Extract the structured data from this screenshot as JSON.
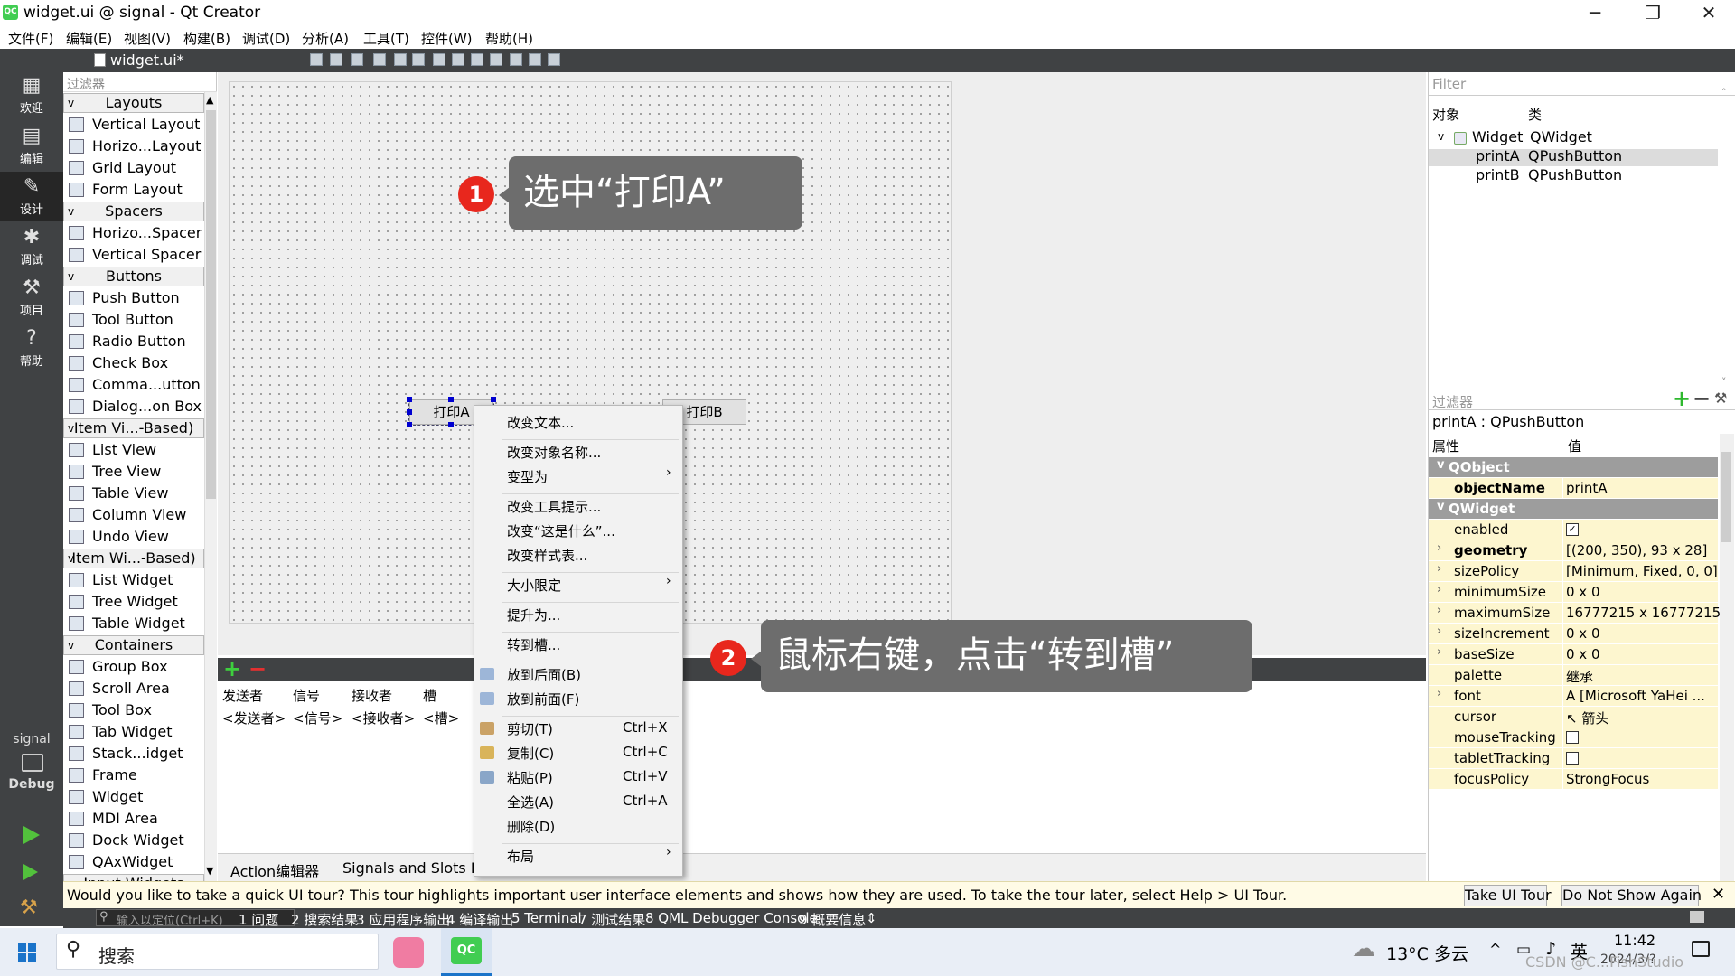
{
  "window": {
    "title": "widget.ui @ signal - Qt Creator",
    "min": "─",
    "max": "❐",
    "close": "✕",
    "logo": "QC"
  },
  "menu": [
    "文件(F)",
    "编辑(E)",
    "视图(V)",
    "构建(B)",
    "调试(D)",
    "分析(A)",
    "工具(T)",
    "控件(W)",
    "帮助(H)"
  ],
  "modes": [
    {
      "label": "欢迎",
      "icon": "grid-icon",
      "glyph": "▦"
    },
    {
      "label": "编辑",
      "icon": "document-icon",
      "glyph": "▤"
    },
    {
      "label": "设计",
      "icon": "pencil-icon",
      "glyph": "✎"
    },
    {
      "label": "调试",
      "icon": "bug-icon",
      "glyph": "✱"
    },
    {
      "label": "项目",
      "icon": "wrench-icon",
      "glyph": "⚒"
    },
    {
      "label": "帮助",
      "icon": "help-icon",
      "glyph": "?"
    }
  ],
  "kit": {
    "project": "signal",
    "mode": "Debug"
  },
  "editor": {
    "doc_tab": "widget.ui*",
    "close": "✕"
  },
  "widgetbox": {
    "filter_placeholder": "过滤器",
    "items": [
      {
        "t": "cat",
        "label": "Layouts"
      },
      {
        "t": "item",
        "label": "Vertical Layout",
        "icon": "vertical-layout-icon"
      },
      {
        "t": "item",
        "label": "Horizo...Layout",
        "icon": "horizontal-layout-icon"
      },
      {
        "t": "item",
        "label": "Grid Layout",
        "icon": "grid-layout-icon"
      },
      {
        "t": "item",
        "label": "Form Layout",
        "icon": "form-layout-icon"
      },
      {
        "t": "cat",
        "label": "Spacers"
      },
      {
        "t": "item",
        "label": "Horizo...Spacer",
        "icon": "horizontal-spacer-icon"
      },
      {
        "t": "item",
        "label": "Vertical Spacer",
        "icon": "vertical-spacer-icon"
      },
      {
        "t": "cat",
        "label": "Buttons"
      },
      {
        "t": "item",
        "label": "Push Button",
        "icon": "push-button-icon"
      },
      {
        "t": "item",
        "label": "Tool Button",
        "icon": "tool-button-icon"
      },
      {
        "t": "item",
        "label": "Radio Button",
        "icon": "radio-button-icon"
      },
      {
        "t": "item",
        "label": "Check Box",
        "icon": "check-box-icon"
      },
      {
        "t": "item",
        "label": "Comma...utton",
        "icon": "command-link-icon"
      },
      {
        "t": "item",
        "label": "Dialog...on Box",
        "icon": "dialog-button-box-icon"
      },
      {
        "t": "cat",
        "label": "Item Vi...-Based)"
      },
      {
        "t": "item",
        "label": "List View",
        "icon": "list-view-icon"
      },
      {
        "t": "item",
        "label": "Tree View",
        "icon": "tree-view-icon"
      },
      {
        "t": "item",
        "label": "Table View",
        "icon": "table-view-icon"
      },
      {
        "t": "item",
        "label": "Column View",
        "icon": "column-view-icon"
      },
      {
        "t": "item",
        "label": "Undo View",
        "icon": "undo-view-icon"
      },
      {
        "t": "cat",
        "label": "Item Wi...-Based)"
      },
      {
        "t": "item",
        "label": "List Widget",
        "icon": "list-widget-icon"
      },
      {
        "t": "item",
        "label": "Tree Widget",
        "icon": "tree-widget-icon"
      },
      {
        "t": "item",
        "label": "Table Widget",
        "icon": "table-widget-icon"
      },
      {
        "t": "cat",
        "label": "Containers"
      },
      {
        "t": "item",
        "label": "Group Box",
        "icon": "group-box-icon"
      },
      {
        "t": "item",
        "label": "Scroll Area",
        "icon": "scroll-area-icon"
      },
      {
        "t": "item",
        "label": "Tool Box",
        "icon": "tool-box-icon"
      },
      {
        "t": "item",
        "label": "Tab Widget",
        "icon": "tab-widget-icon"
      },
      {
        "t": "item",
        "label": "Stack...idget",
        "icon": "stacked-widget-icon"
      },
      {
        "t": "item",
        "label": "Frame",
        "icon": "frame-icon"
      },
      {
        "t": "item",
        "label": "Widget",
        "icon": "widget-icon"
      },
      {
        "t": "item",
        "label": "MDI Area",
        "icon": "mdi-area-icon"
      },
      {
        "t": "item",
        "label": "Dock Widget",
        "icon": "dock-widget-icon"
      },
      {
        "t": "item",
        "label": "QAxWidget",
        "icon": "qaxwidget-icon"
      },
      {
        "t": "cat",
        "label": "Input Widgets"
      }
    ]
  },
  "form": {
    "buttonA": "打印A",
    "buttonB": "打印B"
  },
  "callouts": [
    {
      "num": "1",
      "text": "选中“打印A”"
    },
    {
      "num": "2",
      "text": "鼠标右键，点击“转到槽”"
    }
  ],
  "signals": {
    "add": "+",
    "remove": "−",
    "headers": [
      "发送者",
      "信号",
      "接收者",
      "槽"
    ],
    "row": [
      "<发送者>",
      "<信号>",
      "<接收者>",
      "<槽>"
    ]
  },
  "bottom_tabs": [
    "Action编辑器",
    "Signals and Slots Ed"
  ],
  "context_menu": {
    "items": [
      {
        "label": "改变文本..."
      },
      {
        "sep": true
      },
      {
        "label": "改变对象名称..."
      },
      {
        "label": "变型为",
        "sub": "›"
      },
      {
        "sep": true
      },
      {
        "label": "改变工具提示..."
      },
      {
        "label": "改变“这是什么”..."
      },
      {
        "label": "改变样式表..."
      },
      {
        "sep": true
      },
      {
        "label": "大小限定",
        "sub": "›"
      },
      {
        "sep": true
      },
      {
        "label": "提升为..."
      },
      {
        "sep": true
      },
      {
        "label": "转到槽..."
      },
      {
        "sep": true
      },
      {
        "label": "放到后面(B)",
        "icon": "send-back-icon"
      },
      {
        "label": "放到前面(F)",
        "icon": "bring-front-icon"
      },
      {
        "sep": true
      },
      {
        "label": "剪切(T)",
        "sc": "Ctrl+X",
        "icon": "cut-icon"
      },
      {
        "label": "复制(C)",
        "sc": "Ctrl+C",
        "icon": "copy-icon"
      },
      {
        "label": "粘贴(P)",
        "sc": "Ctrl+V",
        "icon": "paste-icon"
      },
      {
        "label": "全选(A)",
        "sc": "Ctrl+A"
      },
      {
        "label": "删除(D)"
      },
      {
        "sep": true
      },
      {
        "label": "布局",
        "sub": "›"
      }
    ]
  },
  "object_inspector": {
    "filter_placeholder": "Filter",
    "col_object": "对象",
    "col_class": "类",
    "rows": [
      {
        "obj": "Widget",
        "cls": "QWidget",
        "level": 0
      },
      {
        "obj": "printA",
        "cls": "QPushButton",
        "level": 1
      },
      {
        "obj": "printB",
        "cls": "QPushButton",
        "level": 1
      }
    ]
  },
  "property_editor": {
    "filter_placeholder": "过滤器",
    "add": "+",
    "remove": "−",
    "wrench": "⚒",
    "title": "printA : QPushButton",
    "col_prop": "属性",
    "col_value": "值",
    "rows": [
      {
        "g": true,
        "name": "QObject"
      },
      {
        "name": "objectName",
        "val": "printA",
        "bold": true
      },
      {
        "g": true,
        "name": "QWidget"
      },
      {
        "name": "enabled",
        "chk": true,
        "checked": true
      },
      {
        "name": "geometry",
        "val": "[(200, 350), 93 x 28]",
        "bold": true,
        "ex": true
      },
      {
        "name": "sizePolicy",
        "val": "[Minimum, Fixed, 0, 0]",
        "ex": true
      },
      {
        "name": "minimumSize",
        "val": "0 x 0",
        "ex": true
      },
      {
        "name": "maximumSize",
        "val": "16777215 x 16777215",
        "ex": true
      },
      {
        "name": "sizeIncrement",
        "val": "0 x 0",
        "ex": true
      },
      {
        "name": "baseSize",
        "val": "0 x 0",
        "ex": true
      },
      {
        "name": "palette",
        "val": "继承"
      },
      {
        "name": "font",
        "val": "A  [Microsoft YaHei ...",
        "ex": true
      },
      {
        "name": "cursor",
        "val": "↖ 箭头"
      },
      {
        "name": "mouseTracking",
        "chk": true,
        "checked": false
      },
      {
        "name": "tabletTracking",
        "chk": true,
        "checked": false
      },
      {
        "name": "focusPolicy",
        "val": "StrongFocus"
      }
    ]
  },
  "tour": {
    "message": "Would you like to take a quick UI tour? This tour highlights important user interface elements and shows how they are used. To take the tour later, select Help > UI Tour.",
    "take": "Take UI Tour",
    "dont": "Do Not Show Again",
    "close": "✕"
  },
  "output": {
    "locate_placeholder": "输入以定位(Ctrl+K)",
    "panes": [
      "1 问题",
      "2 搜索结果",
      "3 应用程序输出",
      "4 编译输出",
      "5 Terminal",
      "7 测试结果",
      "8 QML Debugger Console",
      "9 概要信息"
    ],
    "arrows": "⇕"
  },
  "taskbar": {
    "search": "搜索",
    "weather": "13°C 多云",
    "lang": "英",
    "time": "11:42",
    "date": "2024/3/?",
    "watermark": "CSDN @C...FishStudio",
    "app1": "bilibili",
    "app2": "QC"
  },
  "colors": {
    "dark": "#404244",
    "accent": "#41cd52",
    "callout": "#6d6d6d",
    "badge": "#e8271d",
    "property_highlight": "#fdf6cf"
  }
}
